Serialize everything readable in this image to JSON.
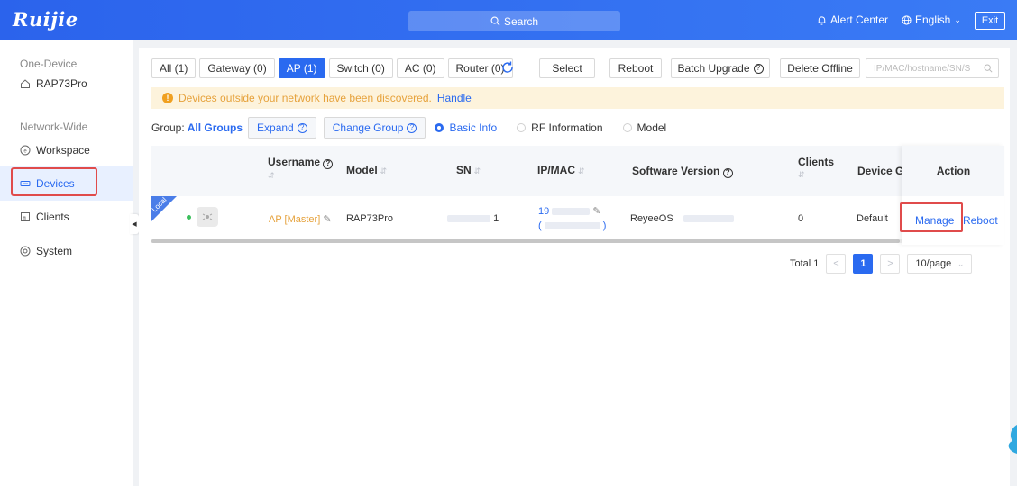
{
  "header": {
    "logo": "Ruijie",
    "search": "Search",
    "alert_center": "Alert Center",
    "language": "English",
    "exit": "Exit"
  },
  "sidebar": {
    "section_one_device": "One-Device",
    "device_name": "RAP73Pro",
    "section_network": "Network-Wide",
    "items": [
      {
        "label": "Workspace",
        "icon": "workspace-icon"
      },
      {
        "label": "Devices",
        "icon": "devices-icon",
        "active": true
      },
      {
        "label": "Clients",
        "icon": "clients-icon"
      },
      {
        "label": "System",
        "icon": "system-icon"
      }
    ]
  },
  "tabs": [
    {
      "label": "All (1)"
    },
    {
      "label": "Gateway (0)"
    },
    {
      "label": "AP (1)",
      "active": true
    },
    {
      "label": "Switch (0)"
    },
    {
      "label": "AC (0)"
    },
    {
      "label": "Router (0)"
    }
  ],
  "toolbar": {
    "select": "Select",
    "reboot": "Reboot",
    "batch_upgrade": "Batch Upgrade",
    "delete_offline": "Delete Offline",
    "search_placeholder": "IP/MAC/hostname/SN/S"
  },
  "banner": {
    "message": "Devices outside your network have been discovered.",
    "link": "Handle"
  },
  "group": {
    "label": "Group:",
    "value": "All Groups",
    "expand": "Expand",
    "change_group": "Change Group",
    "views": [
      "Basic Info",
      "RF Information",
      "Model"
    ],
    "selected_view": "Basic Info"
  },
  "table": {
    "columns": {
      "username": "Username",
      "model": "Model",
      "sn": "SN",
      "ip_mac": "IP/MAC",
      "software_version": "Software Version",
      "clients": "Clients",
      "device_group": "Device Gr",
      "action": "Action"
    },
    "rows": [
      {
        "tag": "Local",
        "username": "AP [Master]",
        "model": "RAP73Pro",
        "sn_suffix": "1",
        "ip_prefix": "19",
        "mac_prefix": "(",
        "mac_suffix": ")",
        "software_version": "ReyeeOS",
        "clients": "0",
        "device_group": "Default",
        "actions": [
          "Manage",
          "Reboot"
        ]
      }
    ]
  },
  "pagination": {
    "total": "Total 1",
    "prev": "<",
    "current_page": "1",
    "next": ">",
    "page_size": "10/page"
  },
  "colors": {
    "primary": "#2a6af0",
    "highlight": "#e04b4b",
    "warning": "#e6a23c"
  }
}
